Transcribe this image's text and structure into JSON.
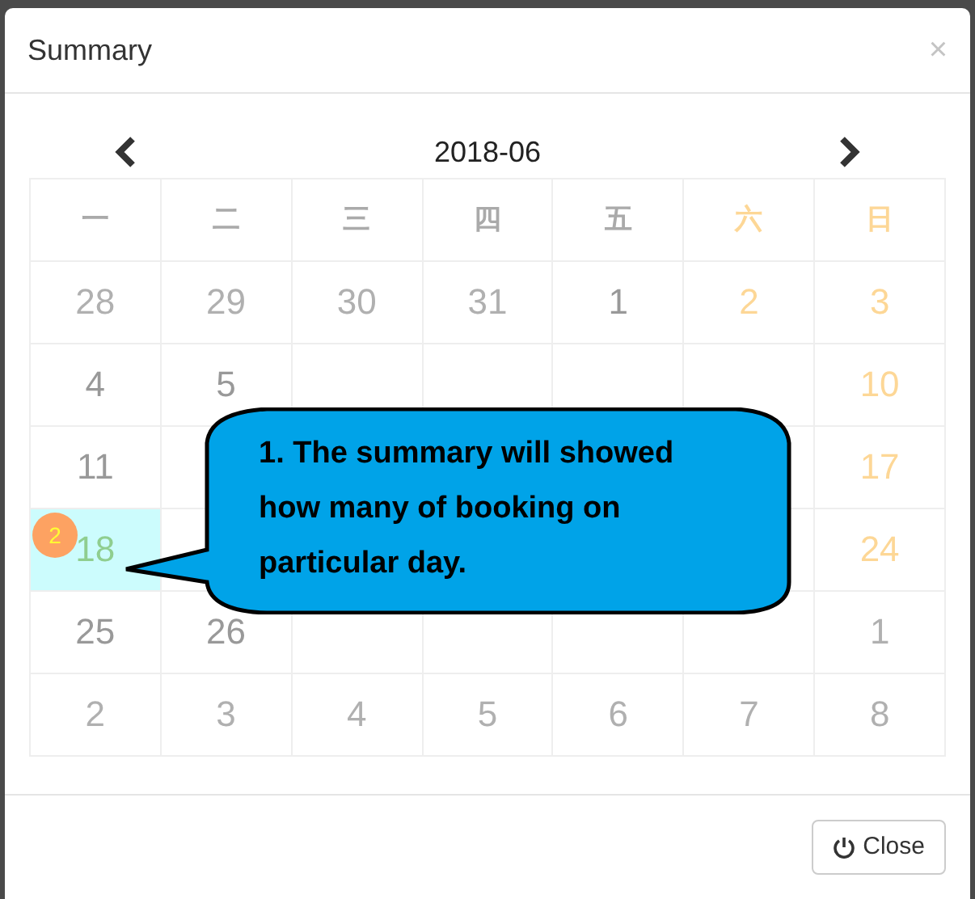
{
  "dialog": {
    "title": "Summary",
    "close_icon": "×"
  },
  "calendar": {
    "month": "2018-06",
    "weekdays": [
      {
        "label": "一",
        "weekend": false
      },
      {
        "label": "二",
        "weekend": false
      },
      {
        "label": "三",
        "weekend": false
      },
      {
        "label": "四",
        "weekend": false
      },
      {
        "label": "五",
        "weekend": false
      },
      {
        "label": "六",
        "weekend": true
      },
      {
        "label": "日",
        "weekend": true
      }
    ],
    "weeks": [
      [
        {
          "day": "28",
          "kind": "other"
        },
        {
          "day": "29",
          "kind": "other"
        },
        {
          "day": "30",
          "kind": "other"
        },
        {
          "day": "31",
          "kind": "other"
        },
        {
          "day": "1",
          "kind": "weekday"
        },
        {
          "day": "2",
          "kind": "weekend"
        },
        {
          "day": "3",
          "kind": "weekend"
        }
      ],
      [
        {
          "day": "4",
          "kind": "weekday"
        },
        {
          "day": "5",
          "kind": "weekday"
        },
        {
          "kind": "covered"
        },
        {
          "kind": "covered"
        },
        {
          "kind": "covered"
        },
        {
          "kind": "covered"
        },
        {
          "day": "10",
          "kind": "weekend"
        }
      ],
      [
        {
          "day": "11",
          "kind": "weekday"
        },
        {
          "kind": "covered"
        },
        {
          "kind": "covered"
        },
        {
          "kind": "covered"
        },
        {
          "kind": "covered"
        },
        {
          "kind": "covered"
        },
        {
          "day": "17",
          "kind": "weekend"
        }
      ],
      [
        {
          "day": "18",
          "kind": "today",
          "badge": "2"
        },
        {
          "kind": "covered"
        },
        {
          "kind": "covered"
        },
        {
          "kind": "covered"
        },
        {
          "kind": "covered"
        },
        {
          "kind": "covered"
        },
        {
          "day": "24",
          "kind": "weekend"
        }
      ],
      [
        {
          "day": "25",
          "kind": "weekday"
        },
        {
          "day": "26",
          "kind": "weekday"
        },
        {
          "kind": "covered"
        },
        {
          "kind": "covered"
        },
        {
          "kind": "covered"
        },
        {
          "kind": "covered"
        },
        {
          "day": "1",
          "kind": "other"
        }
      ],
      [
        {
          "day": "2",
          "kind": "other"
        },
        {
          "day": "3",
          "kind": "other"
        },
        {
          "day": "4",
          "kind": "other"
        },
        {
          "day": "5",
          "kind": "other"
        },
        {
          "day": "6",
          "kind": "other"
        },
        {
          "day": "7",
          "kind": "other"
        },
        {
          "day": "8",
          "kind": "other"
        }
      ]
    ]
  },
  "callout": {
    "text": "1. The summary will showed how many of booking on particular day."
  },
  "footer": {
    "close_button": "Close"
  }
}
